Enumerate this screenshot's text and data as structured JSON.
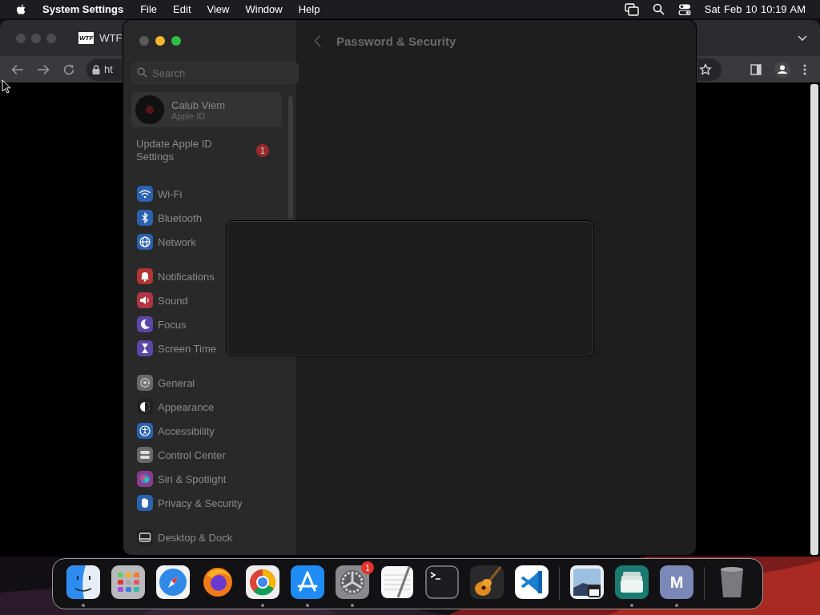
{
  "menu_bar": {
    "app_name": "System Settings",
    "menus": [
      "File",
      "Edit",
      "View",
      "Window",
      "Help"
    ],
    "clock": "Sat Feb 10  10:19 AM"
  },
  "browser": {
    "tab": {
      "favicon_text": "WTF",
      "title": "WTF"
    },
    "url": "ht"
  },
  "settings_window": {
    "search": {
      "placeholder": "Search"
    },
    "account": {
      "name": "Calub Viem",
      "subtitle": "Apple ID"
    },
    "notice": {
      "label": "Update Apple ID Settings",
      "badge": "1"
    },
    "sidebar_groups": [
      [
        {
          "label": "Wi-Fi",
          "color": "#2a62b0"
        },
        {
          "label": "Bluetooth",
          "color": "#2a62b0"
        },
        {
          "label": "Network",
          "color": "#2a62b0"
        }
      ],
      [
        {
          "label": "Notifications",
          "color": "#b03535"
        },
        {
          "label": "Sound",
          "color": "#b03545"
        },
        {
          "label": "Focus",
          "color": "#5b47a8"
        },
        {
          "label": "Screen Time",
          "color": "#5b47a8"
        }
      ],
      [
        {
          "label": "General",
          "color": "#6a6a6a"
        },
        {
          "label": "Appearance",
          "color": "#222222"
        },
        {
          "label": "Accessibility",
          "color": "#2a62b0"
        },
        {
          "label": "Control Center",
          "color": "#6a6a6a"
        },
        {
          "label": "Siri & Spotlight",
          "color": "#8a3c8a"
        },
        {
          "label": "Privacy & Security",
          "color": "#2a62b0"
        }
      ],
      [
        {
          "label": "Desktop & Dock",
          "color": "#222222"
        }
      ]
    ],
    "page_title": "Password & Security"
  },
  "dock": {
    "items": [
      {
        "kind": "app",
        "running": true
      },
      {
        "kind": "app",
        "running": false
      },
      {
        "kind": "app",
        "running": false
      },
      {
        "kind": "app",
        "running": false
      },
      {
        "kind": "app",
        "running": true
      },
      {
        "kind": "app",
        "running": true
      },
      {
        "kind": "app",
        "running": true,
        "badge": "1"
      },
      {
        "kind": "app",
        "running": false
      },
      {
        "kind": "app",
        "running": false
      },
      {
        "kind": "app",
        "running": false
      },
      {
        "kind": "app",
        "running": false
      },
      {
        "kind": "separator"
      },
      {
        "kind": "app",
        "running": false
      },
      {
        "kind": "app",
        "running": true
      },
      {
        "kind": "app",
        "running": true,
        "label": "M"
      },
      {
        "kind": "separator"
      },
      {
        "kind": "trash",
        "running": false
      }
    ]
  }
}
